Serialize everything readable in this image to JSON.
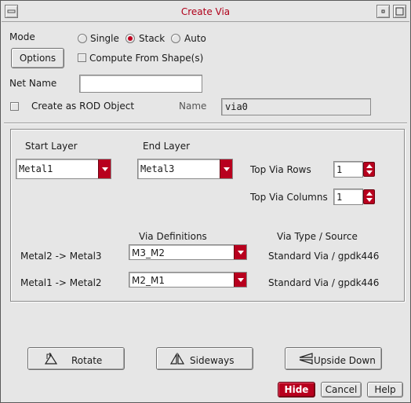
{
  "window": {
    "title": "Create Via",
    "menu_icon": "window-menu-icon",
    "minimize_icon": "minimize-icon",
    "maximize_icon": "maximize-icon"
  },
  "mode": {
    "label": "Mode",
    "options": [
      {
        "label": "Single",
        "selected": false
      },
      {
        "label": "Stack",
        "selected": true
      },
      {
        "label": "Auto",
        "selected": false
      }
    ]
  },
  "options_button": "Options",
  "compute_from_shapes": {
    "label": "Compute From Shape(s)",
    "checked": false
  },
  "net_name": {
    "label": "Net Name",
    "value": ""
  },
  "rod": {
    "label": "Create as ROD Object",
    "checked": false,
    "name_label": "Name",
    "name_value": "via0"
  },
  "layers": {
    "start_label": "Start Layer",
    "start_value": "Metal1",
    "end_label": "End Layer",
    "end_value": "Metal3"
  },
  "top_via_rows": {
    "label": "Top Via Rows",
    "value": "1"
  },
  "top_via_columns": {
    "label": "Top Via Columns",
    "value": "1"
  },
  "via_table": {
    "header_definitions": "Via Definitions",
    "header_type": "Via Type / Source",
    "rows": [
      {
        "layers": "Metal2 -> Metal3",
        "definition": "M3_M2",
        "type": "Standard Via / gpdk446"
      },
      {
        "layers": "Metal1 -> Metal2",
        "definition": "M2_M1",
        "type": "Standard Via / gpdk446"
      }
    ]
  },
  "transform_buttons": {
    "rotate": "Rotate",
    "sideways": "Sideways",
    "upside_down": "Upside Down"
  },
  "footer": {
    "hide": "Hide",
    "cancel": "Cancel",
    "help": "Help"
  },
  "colors": {
    "accent": "#b8001e",
    "title": "#b0001a",
    "background": "#e6e6e6"
  }
}
